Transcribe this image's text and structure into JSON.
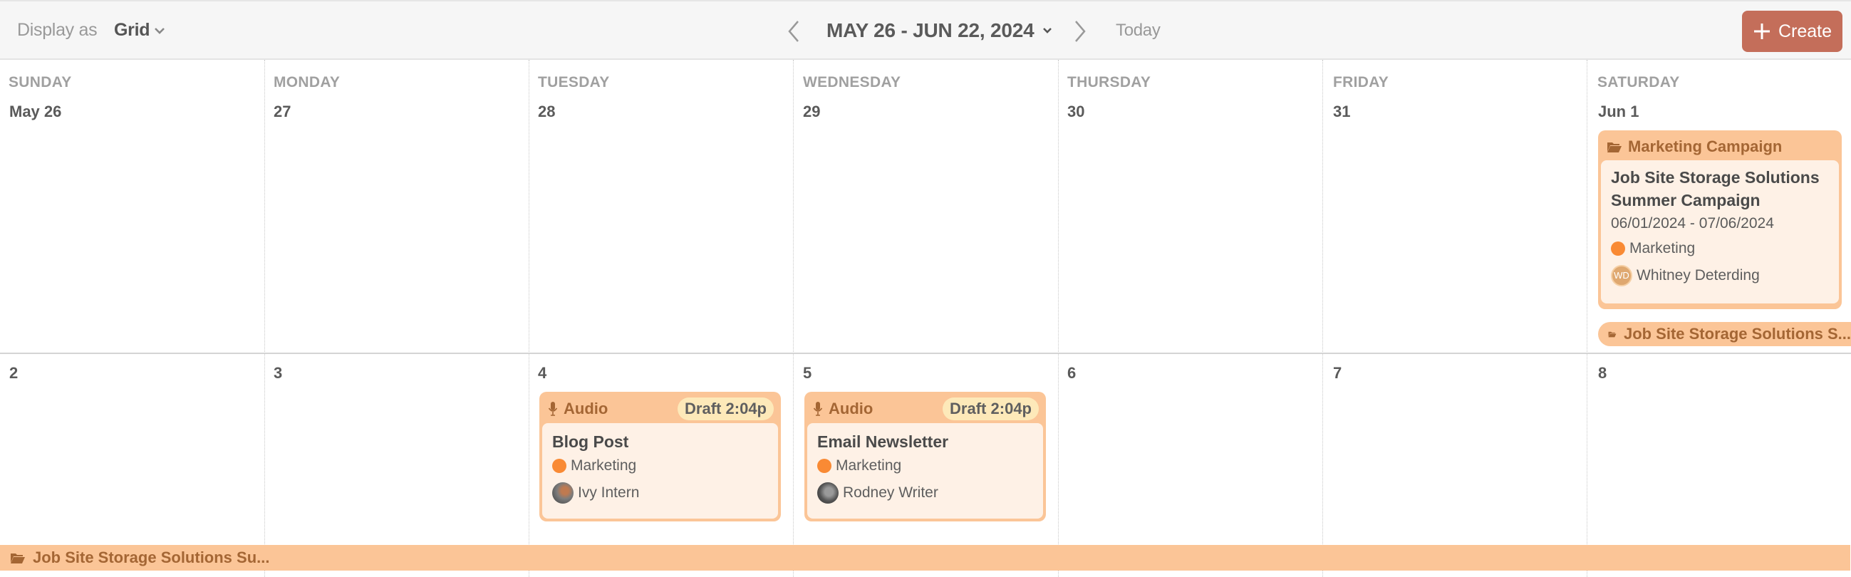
{
  "toolbar": {
    "display_as_label": "Display as",
    "view_mode": "Grid",
    "date_range": "MAY 26 - JUN 22, 2024",
    "today_label": "Today",
    "create_label": "Create"
  },
  "colors": {
    "accent": "#c46e5a",
    "card_header": "#fbc597",
    "card_body": "#fef1e6",
    "card_header_text": "#a46634",
    "status_pill": "#fde9b9",
    "marketing_dot": "#f98a34"
  },
  "weekdays": [
    "SUNDAY",
    "MONDAY",
    "TUESDAY",
    "WEDNESDAY",
    "THURSDAY",
    "FRIDAY",
    "SATURDAY"
  ],
  "weeks": [
    {
      "dates": [
        "May 26",
        "27",
        "28",
        "29",
        "30",
        "31",
        "Jun 1"
      ]
    },
    {
      "dates": [
        "2",
        "3",
        "4",
        "5",
        "6",
        "7",
        "8"
      ]
    }
  ],
  "campaign_card": {
    "type_label": "Marketing Campaign",
    "type_icon": "folder-icon",
    "title": "Job Site Storage Solutions Summer Campaign",
    "dates": "06/01/2024 - 07/06/2024",
    "tag": "Marketing",
    "owner_initials": "WD",
    "owner": "Whitney Deterding"
  },
  "span_bars": {
    "week1_label": "Job Site Storage Solutions S...",
    "week2_label": "Job Site Storage Solutions Su..."
  },
  "audio_cards": [
    {
      "type_label": "Audio",
      "type_icon": "microphone-icon",
      "status": "Draft",
      "time": "2:04p",
      "title": "Blog Post",
      "tag": "Marketing",
      "owner": "Ivy Intern"
    },
    {
      "type_label": "Audio",
      "type_icon": "microphone-icon",
      "status": "Draft",
      "time": "2:04p",
      "title": "Email Newsletter",
      "tag": "Marketing",
      "owner": "Rodney Writer"
    }
  ]
}
